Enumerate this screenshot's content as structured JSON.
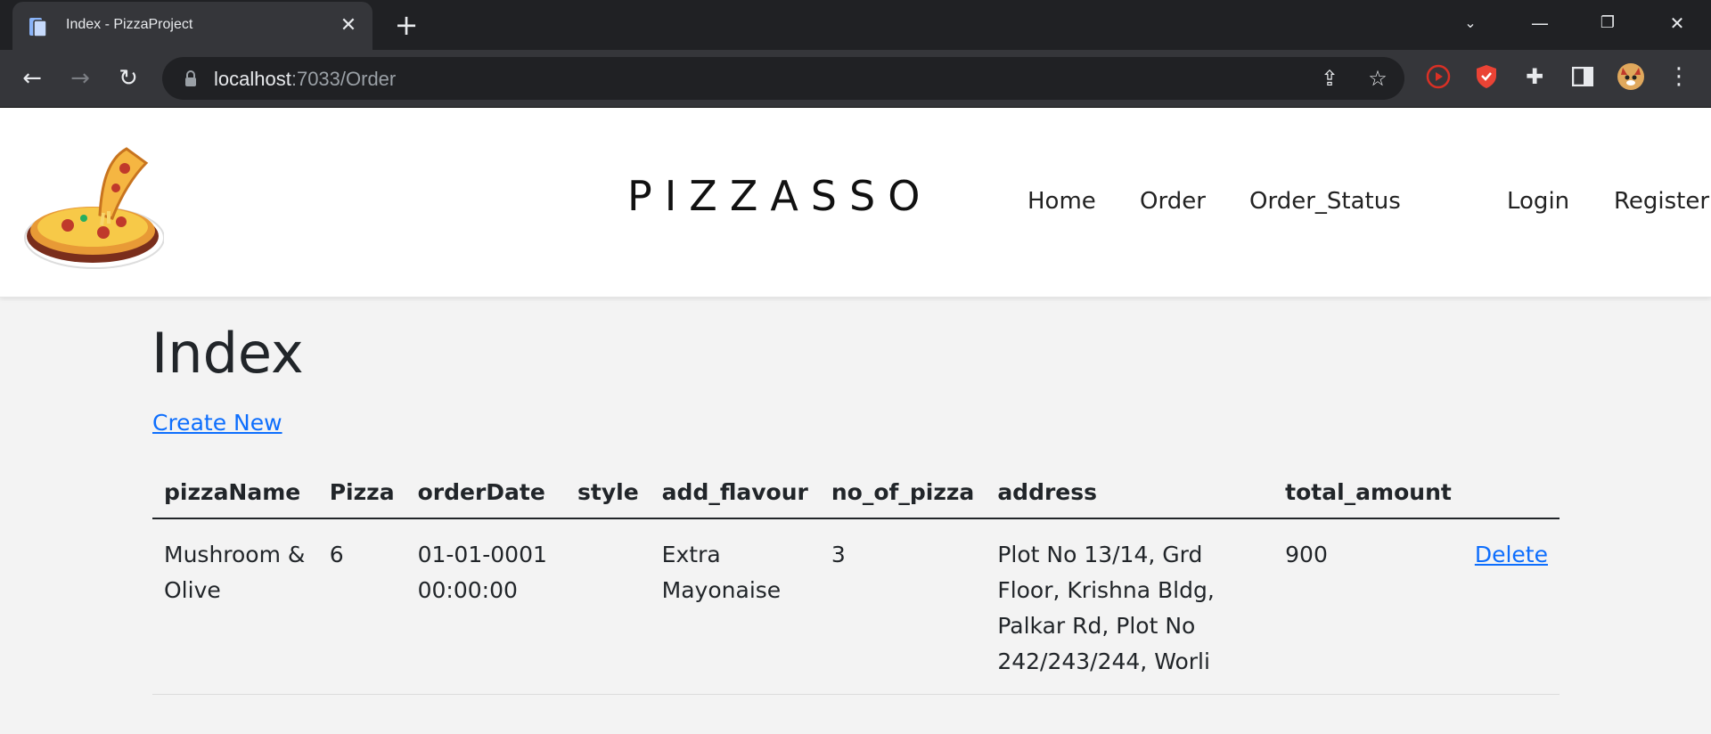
{
  "browser": {
    "tab_title": "Index - PizzaProject",
    "tab_close_icon": "close-icon",
    "new_tab_icon": "plus-icon",
    "window_controls": [
      "chevron-down-icon",
      "minimize-icon",
      "restore-icon",
      "close-icon"
    ],
    "url_host": "localhost",
    "url_rest": ":7033/Order",
    "toolbar_icons": [
      "back-icon",
      "forward-icon",
      "reload-icon",
      "share-icon",
      "star-icon"
    ],
    "extension_icons": [
      "screen-recorder-icon",
      "brave-shield-icon",
      "puzzle-icon",
      "side-panel-icon",
      "profile-avatar-icon",
      "kebab-menu-icon"
    ]
  },
  "header": {
    "logo_icon": "pizza-logo-icon",
    "brand": "PIZZASSO",
    "nav": [
      "Home",
      "Order",
      "Order_Status"
    ],
    "auth": [
      "Login",
      "Register"
    ]
  },
  "main": {
    "title": "Index",
    "create_new": "Create New",
    "table": {
      "headers": [
        "pizzaName",
        "Pizza",
        "orderDate",
        "style",
        "add_flavour",
        "no_of_pizza",
        "address",
        "total_amount",
        ""
      ],
      "rows": [
        {
          "pizzaName": "Mushroom & Olive",
          "pizza": "6",
          "orderDate": "01-01-0001 00:00:00",
          "style": "",
          "add_flavour": "Extra Mayonaise",
          "no_of_pizza": "3",
          "address": "Plot No 13/14, Grd Floor, Krishna Bldg, Palkar Rd, Plot No 242/243/244, Worli",
          "total_amount": "900",
          "delete": "Delete"
        }
      ]
    }
  },
  "colors": {
    "chrome_dark": "#202124",
    "chrome_toolbar": "#35363a",
    "link": "#0d6efd",
    "page_bg": "#f3f3f3"
  }
}
